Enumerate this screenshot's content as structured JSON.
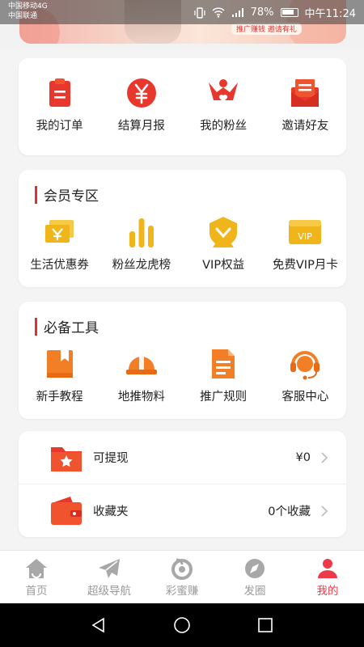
{
  "status_bar": {
    "carrier_1": "中国移动4G",
    "carrier_2": "中国联通",
    "battery": "78%",
    "time": "中午11:24"
  },
  "banner": {
    "caption": "推广赚钱 邀请有礼"
  },
  "quick_actions": [
    {
      "label": "我的订单",
      "icon": "clipboard-icon"
    },
    {
      "label": "结算月报",
      "icon": "yen-coin-icon"
    },
    {
      "label": "我的粉丝",
      "icon": "fans-icon"
    },
    {
      "label": "邀请好友",
      "icon": "envelope-icon"
    }
  ],
  "member_zone": {
    "title": "会员专区",
    "items": [
      {
        "label": "生活优惠券",
        "icon": "coupon-icon"
      },
      {
        "label": "粉丝龙虎榜",
        "icon": "ranking-bars-icon"
      },
      {
        "label": "VIP权益",
        "icon": "vip-badge-icon"
      },
      {
        "label": "免费VIP月卡",
        "icon": "vip-card-icon"
      }
    ],
    "vip_card_text": "VIP"
  },
  "tools": {
    "title": "必备工具",
    "items": [
      {
        "label": "新手教程",
        "icon": "bookmark-icon"
      },
      {
        "label": "地推物料",
        "icon": "helmet-icon"
      },
      {
        "label": "推广规则",
        "icon": "document-icon"
      },
      {
        "label": "客服中心",
        "icon": "headset-icon"
      }
    ]
  },
  "account_rows": [
    {
      "label": "可提现",
      "value": "¥0",
      "icon": "folder-star-icon"
    },
    {
      "label": "收藏夹",
      "value": "0个收藏",
      "icon": "wallet-icon"
    }
  ],
  "tab_bar": [
    {
      "label": "首页",
      "icon": "home-icon"
    },
    {
      "label": "超级导航",
      "icon": "paper-plane-icon"
    },
    {
      "label": "彩蜜赚",
      "icon": "swirl-icon"
    },
    {
      "label": "发圈",
      "icon": "compass-icon"
    },
    {
      "label": "我的",
      "icon": "profile-icon",
      "active": true
    }
  ],
  "colors": {
    "accent_red": "#e8372c",
    "accent_gold": "#f1b51c",
    "accent_orange": "#f27e26",
    "active_tab": "#ec3a4b"
  }
}
